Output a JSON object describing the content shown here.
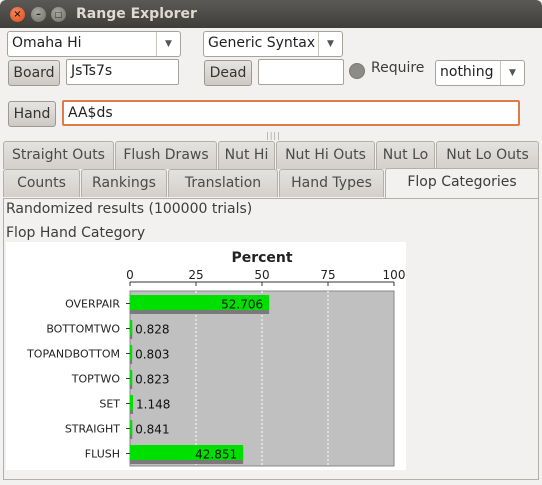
{
  "window": {
    "title": "Range Explorer"
  },
  "controls": {
    "game_select": "Omaha Hi",
    "syntax_select": "Generic Syntax",
    "board_button": "Board",
    "board_value": "JsTs7s",
    "dead_button": "Dead",
    "dead_value": "",
    "require_label": "Require",
    "require_select": "nothing",
    "hand_button": "Hand",
    "hand_value": "AA$ds"
  },
  "tabs_row1": [
    {
      "label": "Straight Outs"
    },
    {
      "label": "Flush Draws"
    },
    {
      "label": "Nut Hi"
    },
    {
      "label": "Nut Hi Outs"
    },
    {
      "label": "Nut Lo"
    },
    {
      "label": "Nut Lo Outs"
    }
  ],
  "tabs_row2": [
    {
      "label": "Counts"
    },
    {
      "label": "Rankings"
    },
    {
      "label": "Translation"
    },
    {
      "label": "Hand Types"
    },
    {
      "label": "Flop Categories",
      "active": true
    }
  ],
  "results": {
    "summary": "Randomized results (100000 trials)",
    "section_title": "Flop Hand Category"
  },
  "chart_data": {
    "type": "bar",
    "orientation": "horizontal",
    "title": "Percent",
    "xlim": [
      0,
      100
    ],
    "ticks": [
      "0",
      "25",
      "50",
      "75",
      "100"
    ],
    "categories": [
      "OVERPAIR",
      "BOTTOMTWO",
      "TOPANDBOTTOM",
      "TOPTWO",
      "SET",
      "STRAIGHT",
      "FLUSH"
    ],
    "values": [
      52.706,
      0.828,
      0.803,
      0.823,
      1.148,
      0.841,
      42.851
    ],
    "labels": [
      "52.706",
      "0.828",
      "0.803",
      "0.823",
      "1.148",
      "0.841",
      "42.851"
    ],
    "bar_color": "#00e000",
    "plot_background": "#c0c0c0"
  }
}
